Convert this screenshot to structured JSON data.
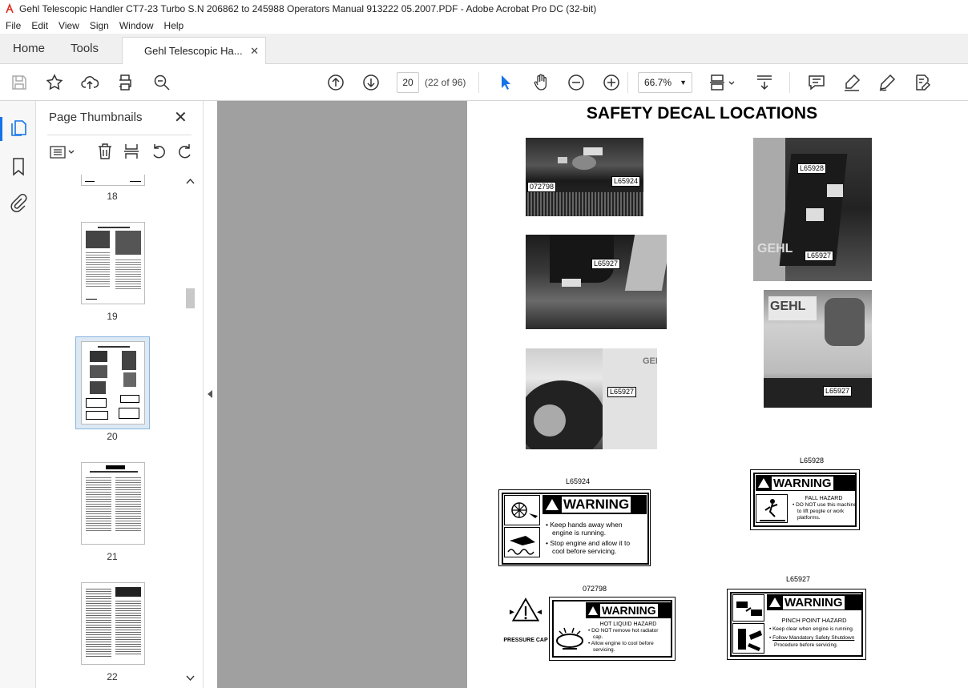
{
  "window": {
    "title": "Gehl Telescopic Handler CT7-23 Turbo S.N 206862 to 245988 Operators Manual 913222 05.2007.PDF - Adobe Acrobat Pro DC (32-bit)"
  },
  "menu": [
    "File",
    "Edit",
    "View",
    "Sign",
    "Window",
    "Help"
  ],
  "tabs": {
    "home": "Home",
    "tools": "Tools",
    "document": "Gehl Telescopic Ha..."
  },
  "toolbar": {
    "page_number": "20",
    "page_total": "(22 of 96)",
    "zoom": "66.7%"
  },
  "sidebar": {
    "title": "Page Thumbnails",
    "thumbnails": [
      {
        "label": "18"
      },
      {
        "label": "19"
      },
      {
        "label": "20"
      },
      {
        "label": "21"
      },
      {
        "label": "22"
      }
    ]
  },
  "document": {
    "heading": "SAFETY DECAL LOCATIONS",
    "photo_labels": {
      "p1a": "072798",
      "p1b": "L65924",
      "p2": "L65927",
      "p3": "L65927",
      "p4a": "L65928",
      "p4b": "L65927",
      "p5": "L65927"
    },
    "photo_text": {
      "gehl": "GEHL",
      "geh": "GEH"
    },
    "decals": {
      "d1": {
        "code": "L65924",
        "title": "WARNING",
        "line1": "Keep hands away when",
        "line2": "engine is running.",
        "line3": "Stop engine and allow it to",
        "line4": "cool before servicing."
      },
      "d2": {
        "code": "L65928",
        "title": "WARNING",
        "hazard": "FALL HAZARD",
        "line1": "DO NOT use this machine",
        "line2": "to lift people or work",
        "line3": "platforms."
      },
      "d3": {
        "code": "072798",
        "title": "WARNING",
        "cap": "PRESSURE CAP",
        "hazard": "HOT LIQUID HAZARD",
        "line1": "DO NOT remove hot radiator",
        "line2": "cap.",
        "line3": "Allow engine to cool before",
        "line4": "servicing."
      },
      "d4": {
        "code": "L65927",
        "title": "WARNING",
        "hazard": "PINCH POINT HAZARD",
        "line1": "Keep clear when engine is running.",
        "line2": "Follow Mandatory Safety Shutdown",
        "line3": "Procedure before servicing."
      }
    }
  }
}
